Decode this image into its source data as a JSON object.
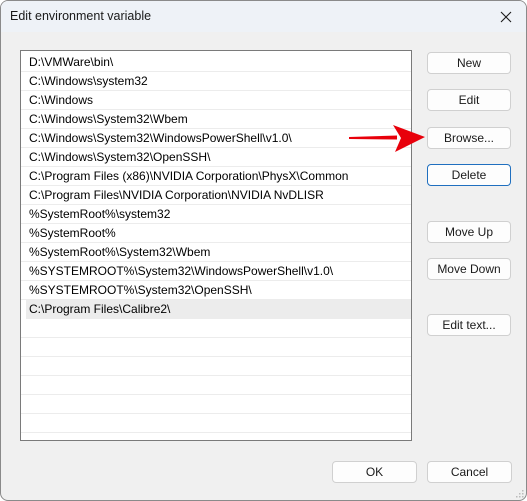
{
  "window": {
    "title": "Edit environment variable",
    "close_icon": "close-x-icon"
  },
  "path_list": {
    "items": [
      "D:\\VMWare\\bin\\",
      "C:\\Windows\\system32",
      "C:\\Windows",
      "C:\\Windows\\System32\\Wbem",
      "C:\\Windows\\System32\\WindowsPowerShell\\v1.0\\",
      "C:\\Windows\\System32\\OpenSSH\\",
      "C:\\Program Files (x86)\\NVIDIA Corporation\\PhysX\\Common",
      "C:\\Program Files\\NVIDIA Corporation\\NVIDIA NvDLISR",
      "%SystemRoot%\\system32",
      "%SystemRoot%",
      "%SystemRoot%\\System32\\Wbem",
      "%SYSTEMROOT%\\System32\\WindowsPowerShell\\v1.0\\",
      "%SYSTEMROOT%\\System32\\OpenSSH\\",
      "C:\\Program Files\\Calibre2\\"
    ],
    "selected_index": 13,
    "empty_rows": 7
  },
  "buttons": {
    "new": "New",
    "edit": "Edit",
    "browse": "Browse...",
    "delete": "Delete",
    "move_up": "Move Up",
    "move_down": "Move Down",
    "edit_text": "Edit text...",
    "ok": "OK",
    "cancel": "Cancel"
  },
  "annotation": {
    "arrow_icon": "red-arrow-icon",
    "arrow_color": "#e8000b",
    "points_to": "Browse..."
  },
  "colors": {
    "default_button_border": "#1f6fbf",
    "selected_row": "#ececec"
  }
}
